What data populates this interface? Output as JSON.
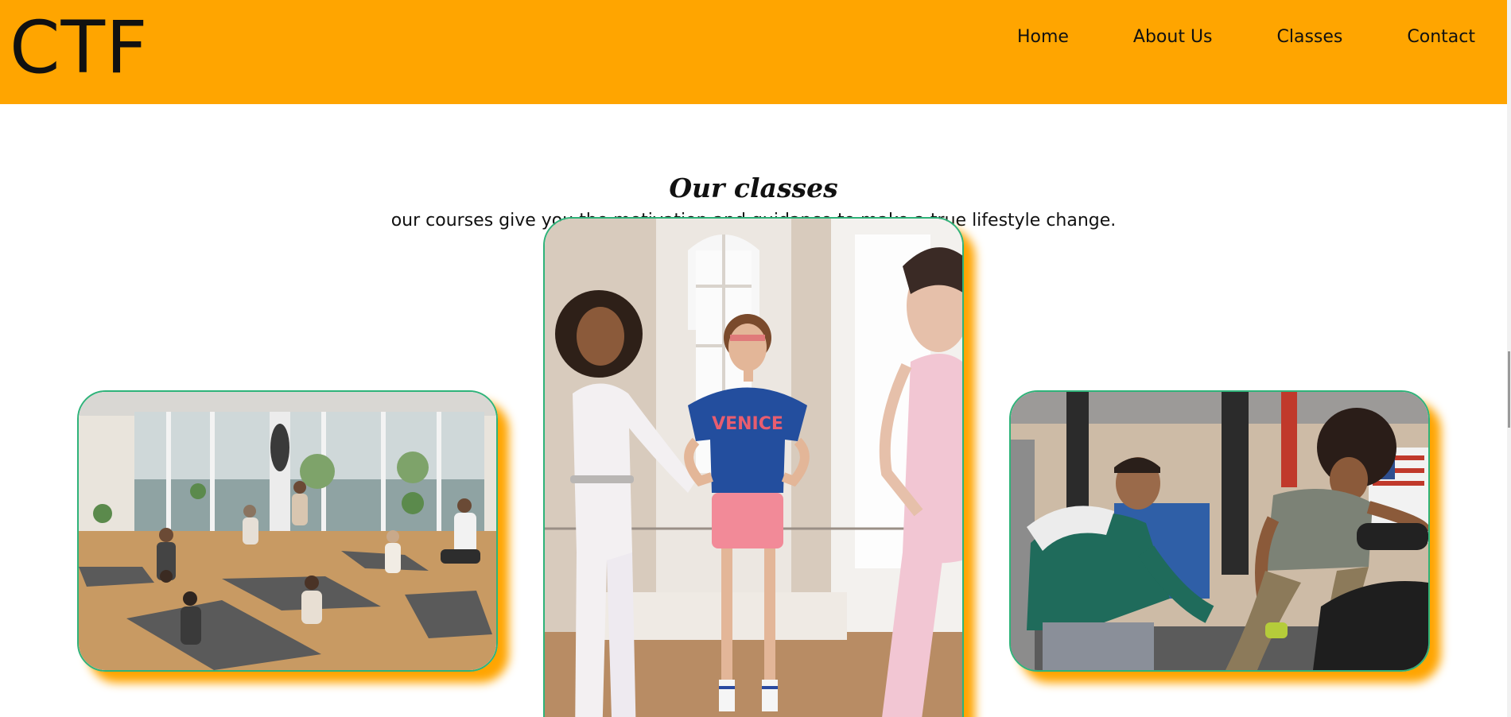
{
  "brand": {
    "logo_text": "CTF",
    "accent": "#ffa500",
    "card_border": "#2fb37a"
  },
  "nav": {
    "items": [
      {
        "label": "Home"
      },
      {
        "label": "About Us"
      },
      {
        "label": "Classes"
      },
      {
        "label": "Contact"
      }
    ]
  },
  "classes": {
    "title": "Our classes",
    "subtitle": "our courses give you the motivation and guidance to make a true lifestyle change.",
    "cards": [
      {
        "image": "yoga-class-photo"
      },
      {
        "image": "aerobics-class-photo",
        "shirt_text": "VENICE"
      },
      {
        "image": "personal-training-photo"
      }
    ]
  }
}
